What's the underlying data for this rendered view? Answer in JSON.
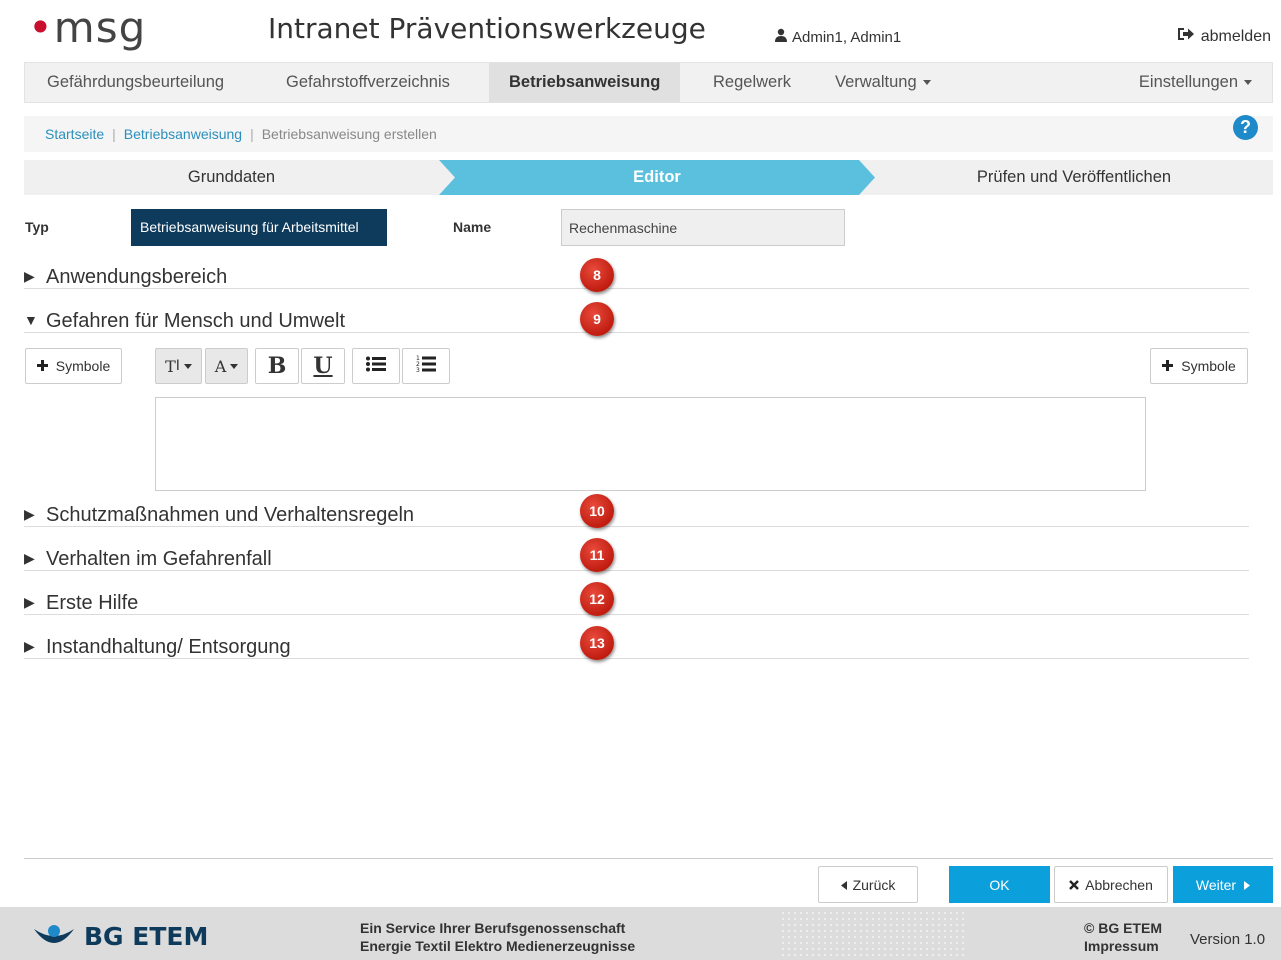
{
  "header": {
    "logo_text": "msg",
    "app_title": "Intranet Präventionswerkzeuge",
    "user_name": "Admin1, Admin1",
    "logout_label": "abmelden"
  },
  "nav": {
    "items": [
      {
        "label": "Gefährdungsbeurteilung"
      },
      {
        "label": "Gefahrstoffverzeichnis"
      },
      {
        "label": "Betriebsanweisung"
      },
      {
        "label": "Regelwerk"
      },
      {
        "label": "Verwaltung"
      },
      {
        "label": "Einstellungen"
      }
    ]
  },
  "breadcrumb": {
    "items": [
      "Startseite",
      "Betriebsanweisung",
      "Betriebsanweisung erstellen"
    ],
    "separator": "|",
    "help": "?"
  },
  "steps": [
    {
      "label": "Grunddaten"
    },
    {
      "label": "Editor"
    },
    {
      "label": "Prüfen und Veröffentlichen"
    }
  ],
  "form": {
    "type_label": "Typ",
    "type_value": "Betriebsanweisung für Arbeitsmittel",
    "name_label": "Name",
    "name_value": "Rechenmaschine"
  },
  "sections": [
    {
      "arrow": "▶",
      "title": "Anwendungsbereich",
      "badge": "8"
    },
    {
      "arrow": "▼",
      "title": "Gefahren für Mensch und Umwelt",
      "badge": "9"
    },
    {
      "arrow": "▶",
      "title": "Schutzmaßnahmen und Verhaltensregeln",
      "badge": "10"
    },
    {
      "arrow": "▶",
      "title": "Verhalten im Gefahrenfall",
      "badge": "11"
    },
    {
      "arrow": "▶",
      "title": "Erste Hilfe",
      "badge": "12"
    },
    {
      "arrow": "▶",
      "title": "Instandhaltung/ Entsorgung",
      "badge": "13"
    }
  ],
  "editor": {
    "symbols_left": "Symbole",
    "symbols_right": "Symbole",
    "text_size_glyph": "T",
    "font_color_glyph": "A",
    "bold_glyph": "B",
    "underline_glyph": "U"
  },
  "actions": {
    "back": "Zurück",
    "ok": "OK",
    "cancel": "Abbrechen",
    "next": "Weiter"
  },
  "footer": {
    "logo_text": "BG ETEM",
    "service_line1": "Ein Service Ihrer Berufsgenossenschaft",
    "service_line2": "Energie Textil Elektro Medienerzeugnisse",
    "copyright": "© BG ETEM",
    "impressum": "Impressum",
    "version": "Version 1.0"
  },
  "colors": {
    "accent": "#0b9fdb",
    "active_step": "#5bc0de",
    "type_box": "#0e3a5c",
    "badge": "#d62b1e"
  }
}
